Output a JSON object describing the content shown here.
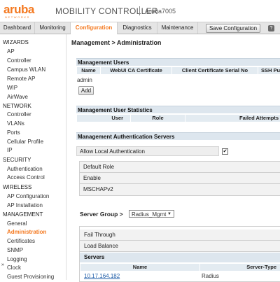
{
  "header": {
    "logo_text": "aruba",
    "logo_sub": "NETWORKS",
    "app_title": "MOBILITY CONTROLLER",
    "device_name": "Aruba7005"
  },
  "tabs": [
    {
      "label": "Dashboard"
    },
    {
      "label": "Monitoring"
    },
    {
      "label": "Configuration"
    },
    {
      "label": "Diagnostics"
    },
    {
      "label": "Maintenance"
    }
  ],
  "toolbar": {
    "save_label": "Save Configuration",
    "help_label": "?"
  },
  "sidebar": {
    "sections": [
      {
        "label": "WIZARDS",
        "items": [
          "AP",
          "Controller",
          "Campus WLAN",
          "Remote AP",
          "WIP",
          "AirWave"
        ]
      },
      {
        "label": "NETWORK",
        "items": [
          "Controller",
          "VLANs",
          "Ports",
          "Cellular Profile",
          "IP"
        ]
      },
      {
        "label": "SECURITY",
        "items": [
          "Authentication",
          "Access Control"
        ]
      },
      {
        "label": "WIRELESS",
        "items": [
          "AP Configuration",
          "AP Installation"
        ]
      },
      {
        "label": "MANAGEMENT",
        "items": [
          "General",
          "Administration",
          "Certificates",
          "SNMP",
          "Logging",
          "Clock",
          "Guest Provisioning"
        ]
      }
    ],
    "active_item": "Administration",
    "arrow_glyph": "»"
  },
  "main": {
    "breadcrumb": "Management > Administration",
    "users": {
      "title": "Management Users",
      "columns": [
        "Name",
        "WebUI CA Certificate",
        "Client Certificate Serial No",
        "SSH Pu"
      ],
      "rows": [
        [
          "admin"
        ]
      ],
      "add_label": "Add"
    },
    "stats": {
      "title": "Management User Statistics",
      "columns": [
        "User",
        "Role",
        "Failed Attempts"
      ]
    },
    "auth": {
      "title": "Management Authentication Servers",
      "allow_local_label": "Allow Local Authentication",
      "allow_local_checked": true,
      "check_glyph": "✔",
      "options": [
        "Default Role",
        "Enable",
        "MSCHAPv2"
      ]
    },
    "server_group": {
      "label": "Server Group >",
      "selected": "Radius_Mgmt",
      "arrow_glyph": "▼",
      "rows": [
        "Fail Through",
        "Load Balance"
      ],
      "servers_title": "Servers",
      "columns": [
        "Name",
        "Server-Type"
      ],
      "servers": [
        [
          "10.17.164.182",
          "Radius"
        ]
      ]
    }
  }
}
